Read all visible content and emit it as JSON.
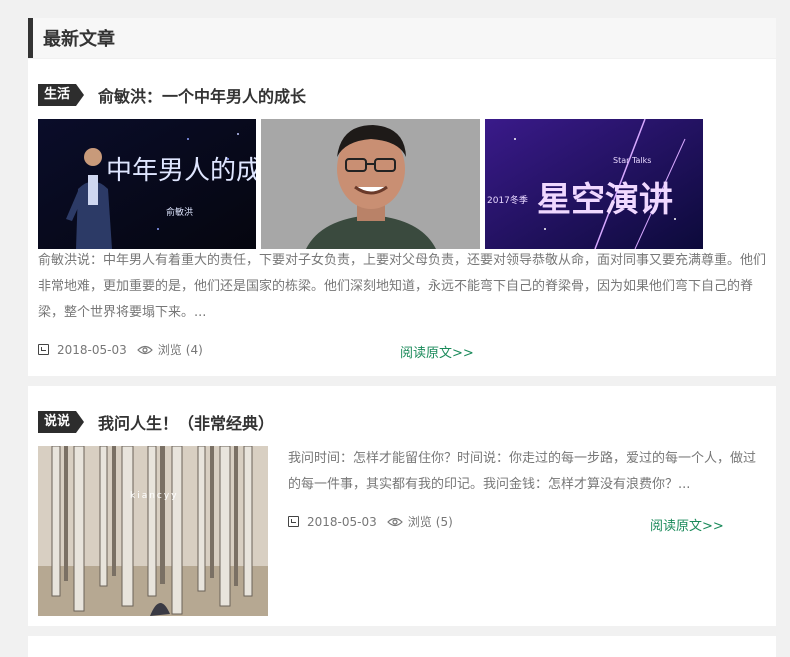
{
  "section": {
    "title": "最新文章"
  },
  "articles": [
    {
      "tag": "生活",
      "title": "俞敏洪：一个中年男人的成长",
      "images": [
        {
          "caption_main": "中年男人的成长",
          "caption_sub": "俞敏洪"
        },
        {
          "caption_main": "",
          "caption_sub": ""
        },
        {
          "caption_main": "星空演讲",
          "caption_sub": "Star Talks",
          "caption_year": "2017冬季"
        }
      ],
      "excerpt": "俞敏洪说：中年男人有着重大的责任，下要对子女负责，上要对父母负责，还要对领导恭敬从命，面对同事又要充满尊重。他们非常地难，更加重要的是，他们还是国家的栋梁。他们深刻地知道，永远不能弯下自己的脊梁骨，因为如果他们弯下自己的脊梁，整个世界将要塌下来。...",
      "date": "2018-05-03",
      "views_label": "浏览",
      "views": "(4)",
      "read_more": "阅读原文>>"
    },
    {
      "tag": "说说",
      "title": "我问人生！（非常经典）",
      "images": [
        {
          "caption_main": "kiancyy"
        }
      ],
      "excerpt": "我问时间：怎样才能留住你？时间说：你走过的每一步路，爱过的每一个人，做过的每一件事，其实都有我的印记。我问金钱：怎样才算没有浪费你？...",
      "date": "2018-05-03",
      "views_label": "浏览",
      "views": "(5)",
      "read_more": "阅读原文>>"
    }
  ],
  "colors": {
    "accent_green": "#1a8a5a",
    "tag_bg": "#2d2d2d",
    "text_gray": "#777777"
  }
}
